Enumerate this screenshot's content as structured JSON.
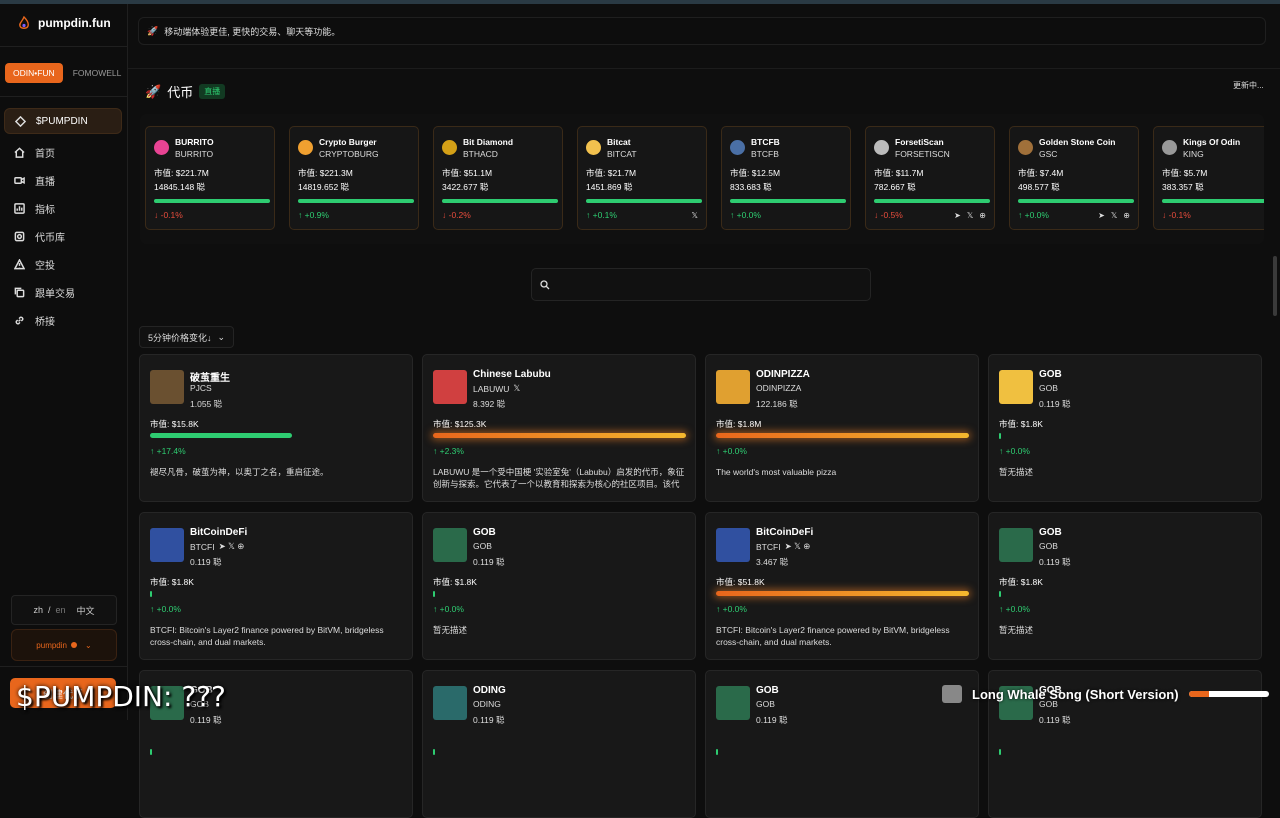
{
  "app": {
    "title": "pumpdin.fun"
  },
  "platforms": [
    "ODIN•FUN",
    "FOMOWELL"
  ],
  "nav": [
    {
      "label": "$PUMPDIN",
      "icon": "diamond-icon"
    },
    {
      "label": "首页",
      "icon": "home-icon"
    },
    {
      "label": "直播",
      "icon": "video-icon"
    },
    {
      "label": "指标",
      "icon": "chart-icon"
    },
    {
      "label": "代币库",
      "icon": "library-icon"
    },
    {
      "label": "空投",
      "icon": "warning-icon"
    },
    {
      "label": "跟单交易",
      "icon": "copy-icon"
    },
    {
      "label": "桥接",
      "icon": "link-icon"
    }
  ],
  "lang": {
    "zh": "zh",
    "sep": "/",
    "en": "en",
    "current": "中文"
  },
  "user": {
    "label": "pumpdin"
  },
  "action_button": {
    "label": "创建代币"
  },
  "announcement": "移动端体验更佳, 更快的交易、聊天等功能。",
  "section": {
    "title": "代币",
    "badge": "直播",
    "status": "更新中..."
  },
  "ticker": [
    {
      "name": "BURRITO",
      "symbol": "BURRITO",
      "mcap": "市值: $221.7M",
      "volume": "14845.148 聪",
      "change": "↓ -0.1%",
      "dir": "down",
      "color": "#e84393",
      "socials": []
    },
    {
      "name": "Crypto Burger",
      "symbol": "CRYPTOBURG",
      "mcap": "市值: $221.3M",
      "volume": "14819.652 聪",
      "change": "↑ +0.9%",
      "dir": "up",
      "color": "#f0a030",
      "socials": []
    },
    {
      "name": "Bit Diamond",
      "symbol": "BTHACD",
      "mcap": "市值: $51.1M",
      "volume": "3422.677 聪",
      "change": "↓ -0.2%",
      "dir": "down",
      "color": "#d4a017",
      "socials": []
    },
    {
      "name": "Bitcat",
      "symbol": "BITCAT",
      "mcap": "市值: $21.7M",
      "volume": "1451.869 聪",
      "change": "↑ +0.1%",
      "dir": "up",
      "color": "#f2c14e",
      "socials": [
        "𝕏"
      ]
    },
    {
      "name": "BTCFB",
      "symbol": "BTCFB",
      "mcap": "市值: $12.5M",
      "volume": "833.683 聪",
      "change": "↑ +0.0%",
      "dir": "up",
      "color": "#4a6fa5",
      "socials": []
    },
    {
      "name": "ForsetiScan",
      "symbol": "FORSETISCN",
      "mcap": "市值: $11.7M",
      "volume": "782.667 聪",
      "change": "↓ -0.5%",
      "dir": "down",
      "color": "#bbbbbb",
      "socials": [
        "➤",
        "𝕏",
        "⊕"
      ]
    },
    {
      "name": "Golden Stone Coin",
      "symbol": "GSC",
      "mcap": "市值: $7.4M",
      "volume": "498.577 聪",
      "change": "↑ +0.0%",
      "dir": "up",
      "color": "#a0703a",
      "socials": [
        "➤",
        "𝕏",
        "⊕"
      ]
    },
    {
      "name": "Kings Of Odin",
      "symbol": "KING",
      "mcap": "市值: $5.7M",
      "volume": "383.357 聪",
      "change": "↓ -0.1%",
      "dir": "down",
      "color": "#999999",
      "socials": []
    }
  ],
  "sort": {
    "label": "5分钟价格变化↓"
  },
  "cards": [
    {
      "name": "破茧重生",
      "symbol": "PJCS",
      "volume": "1.055 聪",
      "mcap": "市值: $15.8K",
      "bar": "g",
      "barfrac": 0.56,
      "change": "↑ +17.4%",
      "desc": "褪尽凡骨，破茧为神，以奥丁之名，重启征途。",
      "img": "#6a5030",
      "socials": ""
    },
    {
      "name": "Chinese Labubu",
      "symbol": "LABUWU",
      "volume": "8.392 聪",
      "mcap": "市值: $125.3K",
      "bar": "o",
      "barfrac": 1.0,
      "change": "↑ +2.3%",
      "desc": "LABUWU 是一个受中国梗 '实验室兔'（Labubu）启发的代币，象征创新与探索。它代表了一个以教育和探索为核心的社区项目。该代币受到...",
      "img": "#d04040",
      "socials": "𝕏"
    },
    {
      "name": "ODINPIZZA",
      "symbol": "ODINPIZZA",
      "volume": "122.186 聪",
      "mcap": "市值: $1.8M",
      "bar": "o",
      "barfrac": 1.0,
      "change": "↑ +0.0%",
      "desc": "The world's most valuable pizza",
      "img": "#e0a030",
      "socials": ""
    },
    {
      "name": "GOB",
      "symbol": "GOB",
      "volume": "0.119 聪",
      "mcap": "市值: $1.8K",
      "bar": "g",
      "barfrac": 0.004,
      "change": "↑ +0.0%",
      "desc": "暂无描述",
      "img": "#f0c040",
      "socials": ""
    },
    {
      "name": "BitCoinDeFi",
      "symbol": "BTCFI",
      "volume": "0.119 聪",
      "mcap": "市值: $1.8K",
      "bar": "g",
      "barfrac": 0.004,
      "change": "↑ +0.0%",
      "desc": "BTCFI: Bitcoin's Layer2 finance powered by BitVM, bridgeless cross-chain, and dual markets.",
      "img": "#3050a0",
      "socials": "➤ 𝕏 ⊕"
    },
    {
      "name": "GOB",
      "symbol": "GOB",
      "volume": "0.119 聪",
      "mcap": "市值: $1.8K",
      "bar": "g",
      "barfrac": 0.004,
      "change": "↑ +0.0%",
      "desc": "暂无描述",
      "img": "#2a6a4a",
      "socials": ""
    },
    {
      "name": "BitCoinDeFi",
      "symbol": "BTCFI",
      "volume": "3.467 聪",
      "mcap": "市值: $51.8K",
      "bar": "o",
      "barfrac": 1.0,
      "change": "↑ +0.0%",
      "desc": "BTCFI: Bitcoin's Layer2 finance powered by BitVM, bridgeless cross-chain, and dual markets.",
      "img": "#3050a0",
      "socials": "➤ 𝕏 ⊕"
    },
    {
      "name": "GOB",
      "symbol": "GOB",
      "volume": "0.119 聪",
      "mcap": "市值: $1.8K",
      "bar": "g",
      "barfrac": 0.004,
      "change": "↑ +0.0%",
      "desc": "暂无描述",
      "img": "#2a6a4a",
      "socials": ""
    },
    {
      "name": "GOB",
      "symbol": "GOB",
      "volume": "0.119 聪",
      "mcap": "",
      "bar": "g",
      "barfrac": 0.004,
      "change": "",
      "desc": "",
      "img": "#2a6a4a",
      "socials": ""
    },
    {
      "name": "ODING",
      "symbol": "ODING",
      "volume": "0.119 聪",
      "mcap": "",
      "bar": "g",
      "barfrac": 0.004,
      "change": "",
      "desc": "",
      "img": "#2a6a6a",
      "socials": ""
    },
    {
      "name": "GOB",
      "symbol": "GOB",
      "volume": "0.119 聪",
      "mcap": "",
      "bar": "g",
      "barfrac": 0.004,
      "change": "",
      "desc": "",
      "img": "#2a6a4a",
      "socials": ""
    },
    {
      "name": "GOB",
      "symbol": "GOB",
      "volume": "0.119 聪",
      "mcap": "",
      "bar": "g",
      "barfrac": 0.004,
      "change": "",
      "desc": "",
      "img": "#2a6a4a",
      "socials": ""
    }
  ],
  "overlay": {
    "title": "$PUMPDIN: ???"
  },
  "player": {
    "song": "Long Whale Song (Short Version)",
    "progress": 0.25
  },
  "colors": {
    "accent": "#e8661c",
    "up": "#2ecc71",
    "down": "#e74c3c",
    "bg": "#0e0e0e"
  }
}
